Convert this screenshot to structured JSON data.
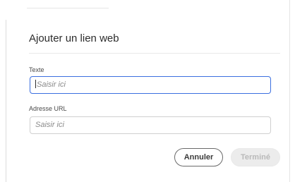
{
  "dialog": {
    "title": "Ajouter un lien web",
    "fields": {
      "text": {
        "label": "Texte",
        "placeholder": "Saisir ici",
        "value": ""
      },
      "url": {
        "label": "Adresse URL",
        "placeholder": "Saisir ici",
        "value": ""
      }
    },
    "buttons": {
      "cancel_label": "Annuler",
      "done_label": "Terminé"
    }
  },
  "colors": {
    "focus_border": "#3b6fe0",
    "disabled_button_bg": "#ececec",
    "disabled_button_text": "#b9b9b9"
  }
}
